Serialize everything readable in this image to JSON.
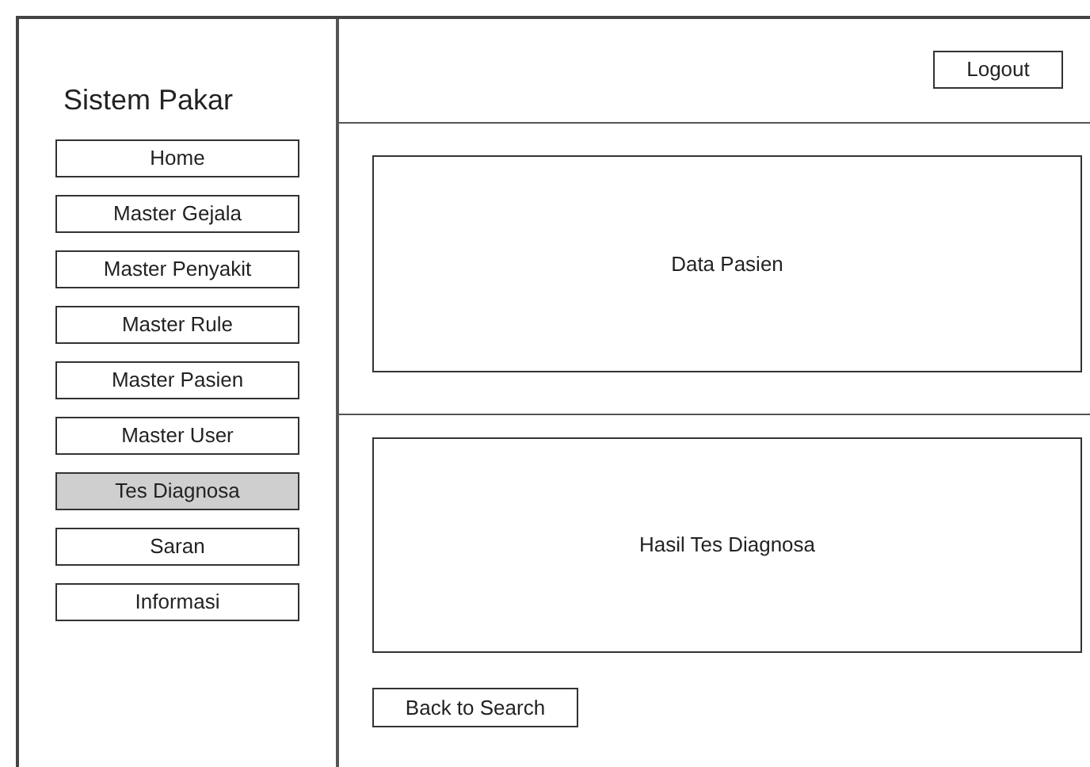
{
  "sidebar": {
    "title": "Sistem Pakar",
    "items": [
      {
        "label": "Home",
        "selected": false
      },
      {
        "label": "Master Gejala",
        "selected": false
      },
      {
        "label": "Master Penyakit",
        "selected": false
      },
      {
        "label": "Master Rule",
        "selected": false
      },
      {
        "label": "Master Pasien",
        "selected": false
      },
      {
        "label": "Master User",
        "selected": false
      },
      {
        "label": "Tes Diagnosa",
        "selected": true
      },
      {
        "label": "Saran",
        "selected": false
      },
      {
        "label": "Informasi",
        "selected": false
      }
    ]
  },
  "header": {
    "logout_button": "Logout"
  },
  "data_panel": {
    "label": "Data Pasien"
  },
  "result_panel": {
    "label": "Hasil Tes Diagnosa"
  },
  "back_button": "Back to Search"
}
